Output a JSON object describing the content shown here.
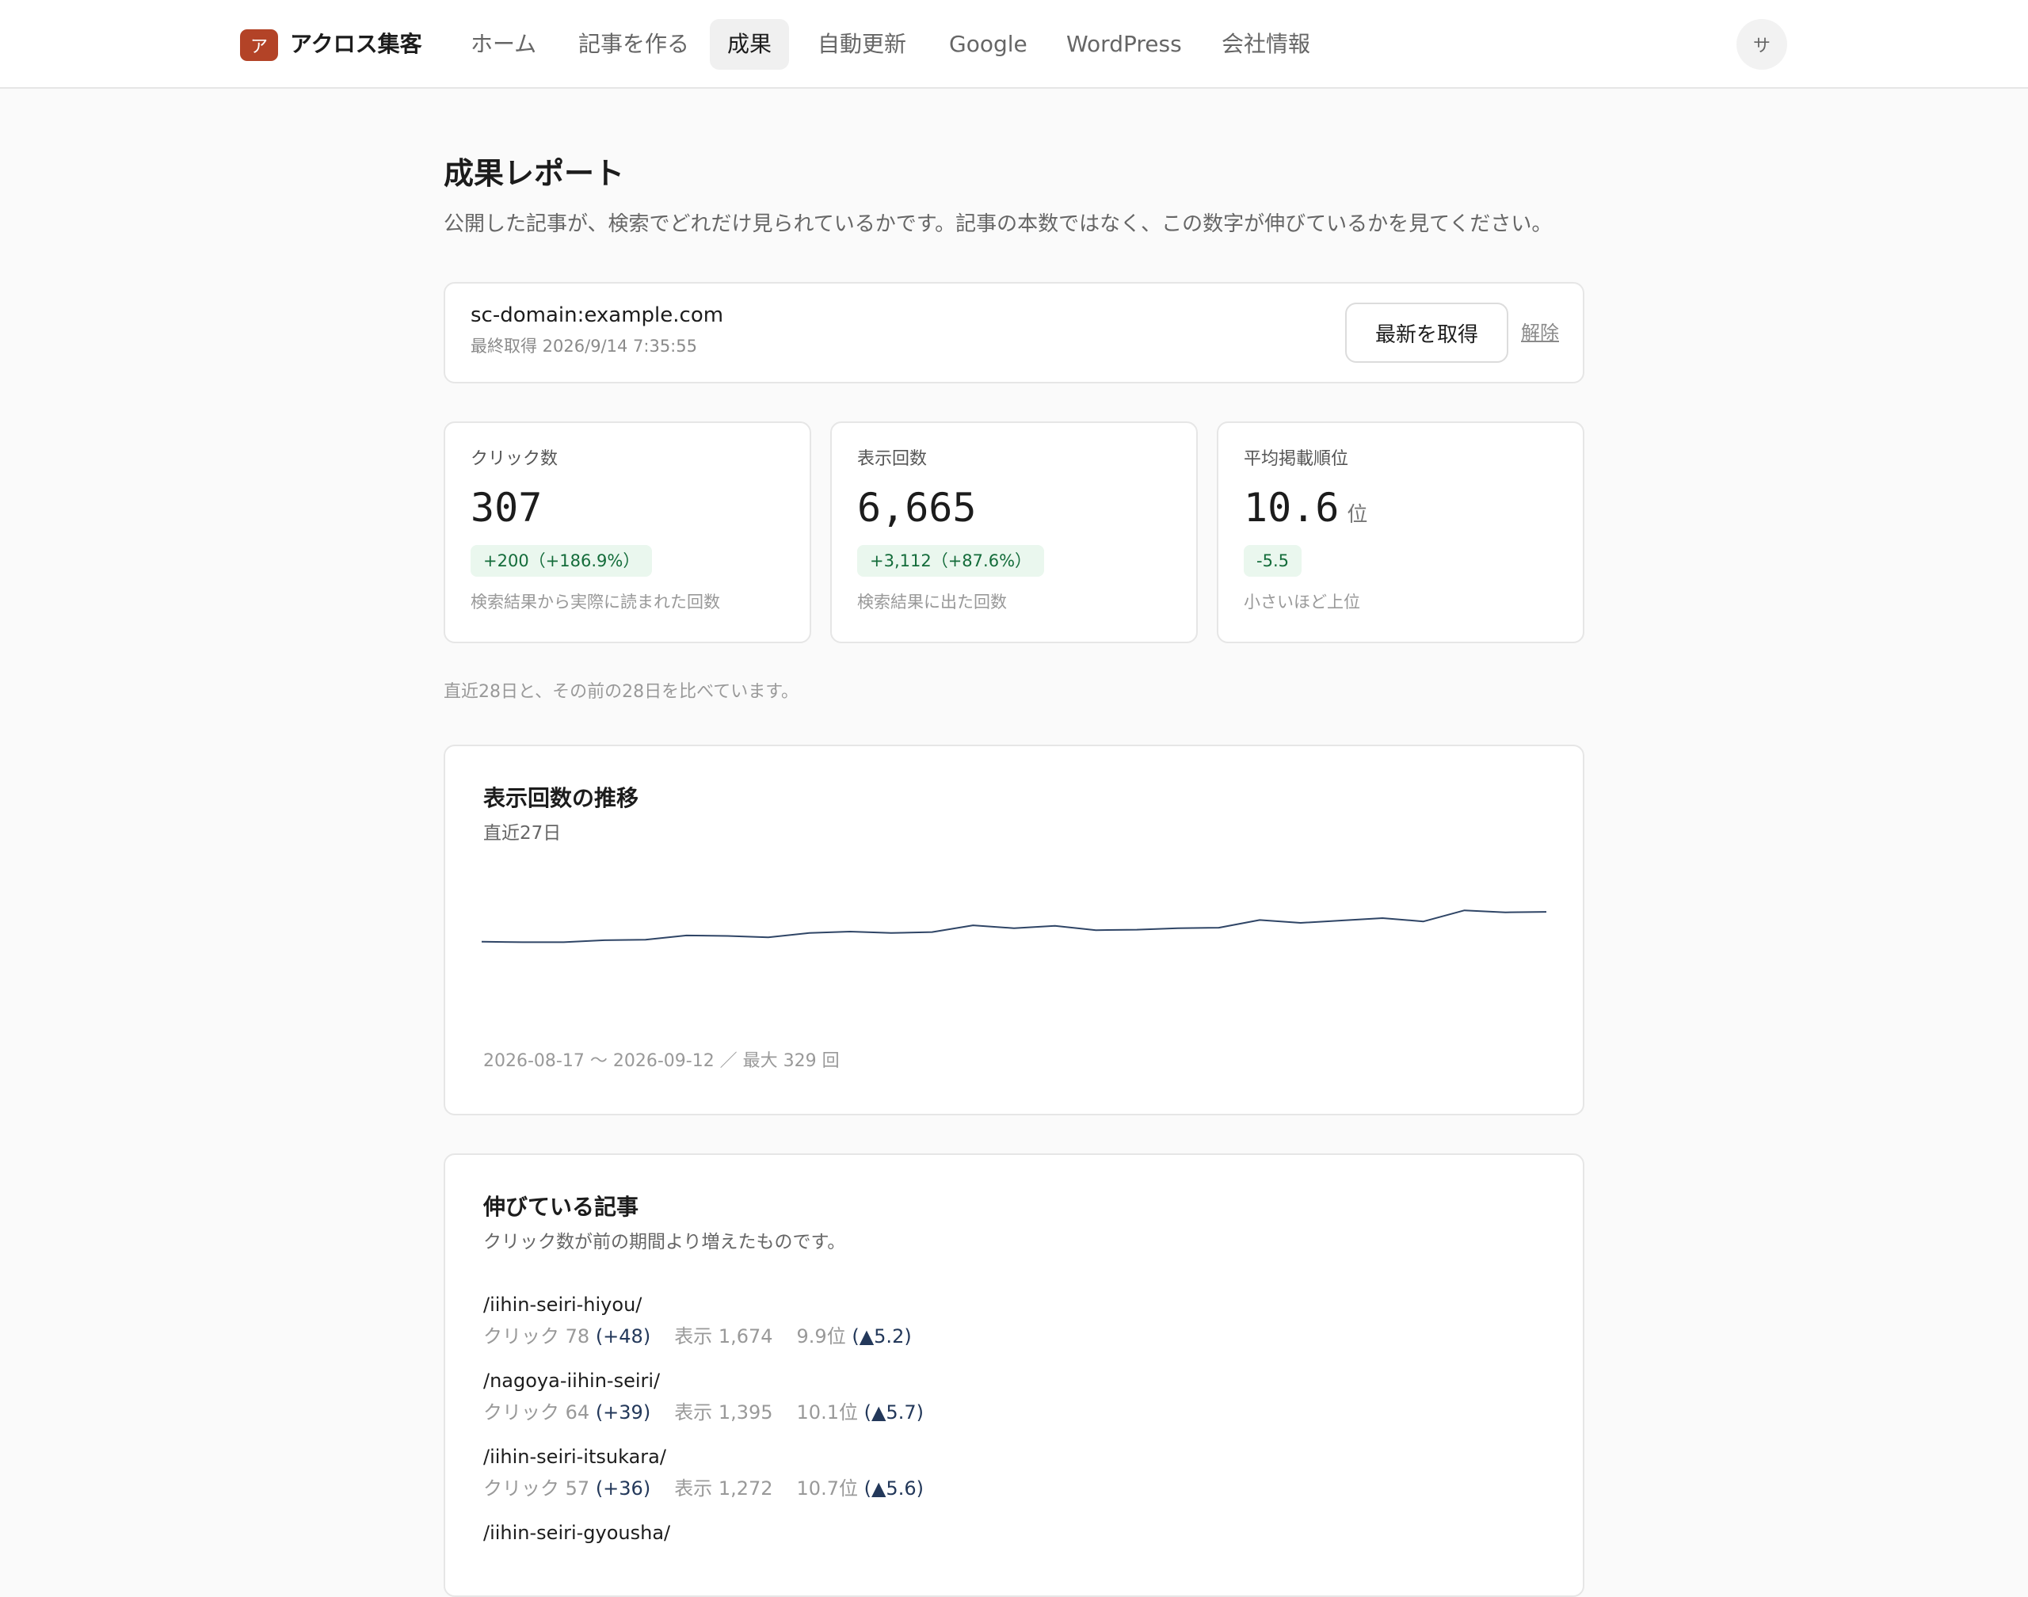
{
  "app": {
    "logo_glyph": "ア",
    "name": "アクロス集客"
  },
  "nav": {
    "items": [
      {
        "label": "ホーム"
      },
      {
        "label": "記事を作る"
      },
      {
        "label": "成果",
        "active": true
      },
      {
        "label": "自動更新"
      },
      {
        "label": "Google"
      },
      {
        "label": "WordPress"
      },
      {
        "label": "会社情報"
      }
    ],
    "avatar_initial": "サ"
  },
  "page": {
    "title": "成果レポート",
    "description": "公開した記事が、検索でどれだけ見られているかです。記事の本数ではなく、この数字が伸びているかを見てください。"
  },
  "property": {
    "domain": "sc-domain:example.com",
    "last_fetched": "最終取得 2026/9/14 7:35:55",
    "refresh_label": "最新を取得",
    "disconnect_label": "解除"
  },
  "metrics": [
    {
      "label": "クリック数",
      "value": "307",
      "unit": "",
      "delta": "+200（+186.9%）",
      "note": "検索結果から実際に読まれた回数"
    },
    {
      "label": "表示回数",
      "value": "6,665",
      "unit": "",
      "delta": "+3,112（+87.6%）",
      "note": "検索結果に出た回数"
    },
    {
      "label": "平均掲載順位",
      "value": "10.6",
      "unit": "位",
      "delta": "-5.5",
      "note": "小さいほど上位"
    }
  ],
  "comparison_note": "直近28日と、その前の28日を比べています。",
  "impressions_chart": {
    "title": "表示回数の推移",
    "subtitle": "直近27日",
    "footer": "2026-08-17 〜 2026-09-12 ／ 最大 329 回",
    "line_color": "#2f4566",
    "chart_data": {
      "type": "line",
      "title": "表示回数の推移",
      "x_range": [
        "2026-08-17",
        "2026-09-12"
      ],
      "ylim": [
        0,
        329
      ],
      "grid": false,
      "values": [
        183,
        182,
        182,
        186,
        187,
        196,
        195,
        192,
        201,
        204,
        201,
        203,
        217,
        211,
        216,
        207,
        208,
        211,
        212,
        228,
        222,
        227,
        232,
        225,
        248,
        244,
        245
      ]
    }
  },
  "growing_articles": {
    "title": "伸びている記事",
    "subtitle": "クリック数が前の期間より増えたものです。",
    "items": [
      {
        "path": "/iihin-seiri-hiyou/",
        "clicks": "クリック 78",
        "clicks_delta": "(+48)",
        "impressions": "表示 1,674",
        "position": "9.9位",
        "position_delta": "(▲5.2)"
      },
      {
        "path": "/nagoya-iihin-seiri/",
        "clicks": "クリック 64",
        "clicks_delta": "(+39)",
        "impressions": "表示 1,395",
        "position": "10.1位",
        "position_delta": "(▲5.7)"
      },
      {
        "path": "/iihin-seiri-itsukara/",
        "clicks": "クリック 57",
        "clicks_delta": "(+36)",
        "impressions": "表示 1,272",
        "position": "10.7位",
        "position_delta": "(▲5.6)"
      },
      {
        "path": "/iihin-seiri-gyousha/"
      }
    ]
  }
}
